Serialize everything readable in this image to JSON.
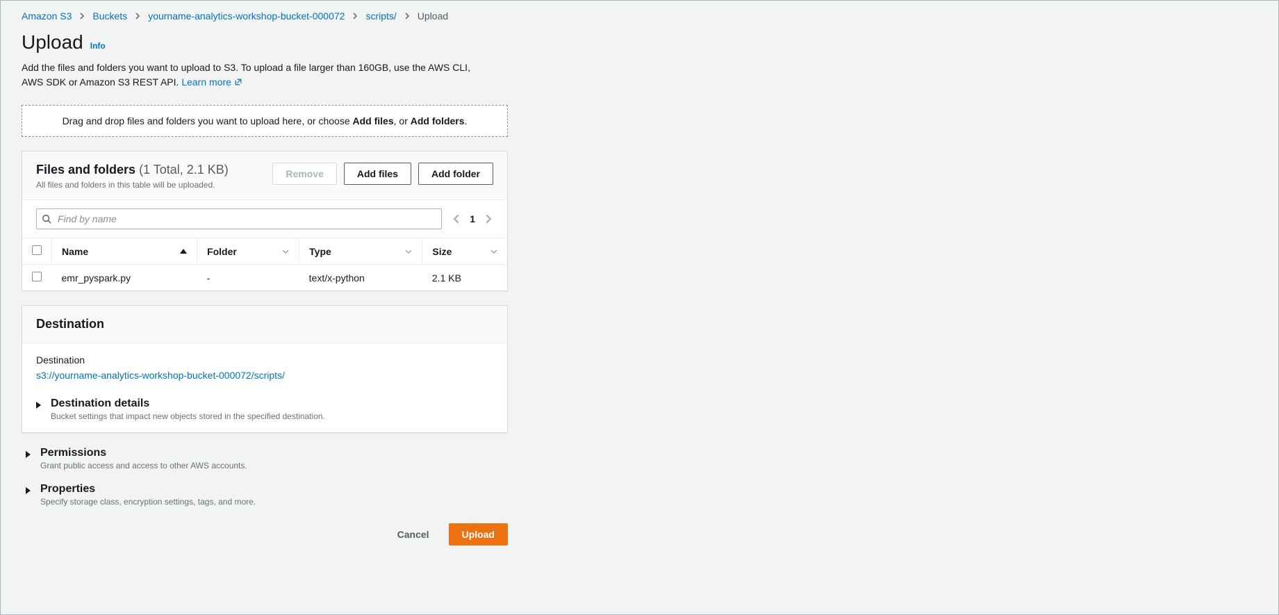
{
  "breadcrumb": {
    "items": [
      {
        "label": "Amazon S3"
      },
      {
        "label": "Buckets"
      },
      {
        "label": "yourname-analytics-workshop-bucket-000072"
      },
      {
        "label": "scripts/"
      }
    ],
    "current": "Upload"
  },
  "header": {
    "title": "Upload",
    "info": "Info"
  },
  "intro": {
    "text_before": "Add the files and folders you want to upload to S3. To upload a file larger than 160GB, use the AWS CLI, AWS SDK or Amazon S3 REST API. ",
    "learn_more": "Learn more"
  },
  "dropzone": {
    "prefix": "Drag and drop files and folders you want to upload here, or choose ",
    "add_files_b": "Add files",
    "mid": ", or ",
    "add_folders_b": "Add folders",
    "suffix": "."
  },
  "files_panel": {
    "title": "Files and folders",
    "count_text": "(1 Total, 2.1 KB)",
    "subtext": "All files and folders in this table will be uploaded.",
    "remove_btn": "Remove",
    "add_files_btn": "Add files",
    "add_folder_btn": "Add folder",
    "search_placeholder": "Find by name",
    "page": "1",
    "columns": {
      "name": "Name",
      "folder": "Folder",
      "type": "Type",
      "size": "Size"
    },
    "rows": [
      {
        "name": "emr_pyspark.py",
        "folder": "-",
        "type": "text/x-python",
        "size": "2.1 KB"
      }
    ]
  },
  "destination_panel": {
    "heading": "Destination",
    "label": "Destination",
    "value": "s3://yourname-analytics-workshop-bucket-000072/scripts/",
    "details_title": "Destination details",
    "details_sub": "Bucket settings that impact new objects stored in the specified destination."
  },
  "permissions": {
    "title": "Permissions",
    "sub": "Grant public access and access to other AWS accounts."
  },
  "properties": {
    "title": "Properties",
    "sub": "Specify storage class, encryption settings, tags, and more."
  },
  "footer": {
    "cancel": "Cancel",
    "upload": "Upload"
  }
}
